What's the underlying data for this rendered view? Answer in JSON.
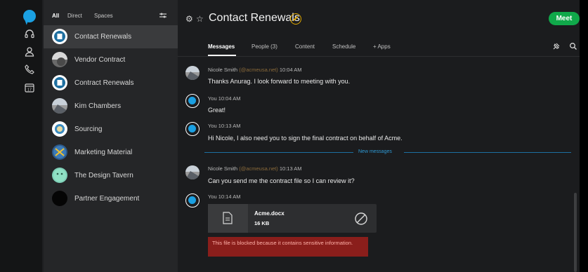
{
  "filters": [
    "All",
    "Direct",
    "Spaces"
  ],
  "spaces": [
    {
      "name": "Contact Renewals",
      "selected": true
    },
    {
      "name": "Vendor Contract"
    },
    {
      "name": "Contract Renewals"
    },
    {
      "name": "Kim Chambers"
    },
    {
      "name": "Sourcing"
    },
    {
      "name": "Marketing Material"
    },
    {
      "name": "The Design Tavern"
    },
    {
      "name": "Partner Engagement"
    }
  ],
  "header": {
    "title": "Contact Renewals",
    "meet_label": "Meet",
    "tabs": [
      "Messages",
      "People (3)",
      "Content",
      "Schedule",
      "+ Apps"
    ]
  },
  "messages": [
    {
      "sender": "Nicole Smith",
      "email": "(@acmeusa.net)",
      "time": "10:04 AM",
      "text": "Thanks Anurag. I look forward to meeting with you."
    },
    {
      "sender": "You",
      "time": "10:04 AM",
      "text": "Great!"
    },
    {
      "sender": "You",
      "time": "10:13 AM",
      "text": "Hi Nicole, I also need you to sign the final contract on behalf of Acme."
    },
    {
      "sender": "Nicole Smith",
      "email": "(@acmeusa.net)",
      "time": "10:13 AM",
      "text": "Can you send me the contract file so I can review it?"
    },
    {
      "sender": "You",
      "time": "10:14 AM"
    }
  ],
  "divider_label": "New messages",
  "file": {
    "name": "Acme.docx",
    "size": "16 KB"
  },
  "blocked_text": "This file is blocked because it contains sensitive information.",
  "colors": {
    "accent": "#1ba0e2",
    "meet": "#10a84a",
    "blocked_bg": "#8a1e1b"
  }
}
